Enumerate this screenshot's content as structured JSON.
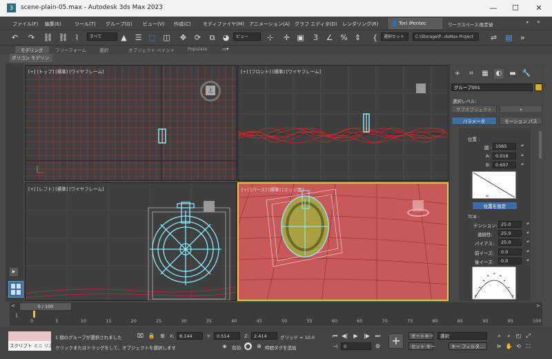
{
  "window": {
    "title": "scene-plain-05.max - Autodesk 3ds Max 2023",
    "app_icon": "3"
  },
  "menu": [
    "ファイル(F)",
    "編集(E)",
    "ツール(T)",
    "グループ(G)",
    "ビュー(V)",
    "作成(C)",
    "モディファイヤ(M)",
    "アニメーション(A)",
    "グラフ エディタ(D)",
    "レンダリング(R)"
  ],
  "user": {
    "name": "Tori iPentec",
    "workspace_label": "ワークスペース:",
    "workspace_value": "既定値"
  },
  "toolbar": {
    "selection_filter": "すべて",
    "ref_coord": "ビュー",
    "named_selection": "選択セット",
    "project_path": "C:\\Storage\\P...dsMax Project"
  },
  "ribbon": {
    "tabs": [
      "モデリング",
      "フリーフォーム",
      "選択",
      "オブジェクト ペイント",
      "Populate"
    ],
    "subtab": "ポリゴン モデリング"
  },
  "viewports": {
    "top": "[+] [トップ] [標準] [ワイヤフレーム]",
    "front": "[+] [フロント] [標準] [ワイヤフレーム]",
    "left": "[+] [レフト] [標準] [ワイヤフレーム]",
    "persp": "[+] [パース] [標準] [エッジ面]",
    "viewcube_top": "上"
  },
  "command_panel": {
    "object_name": "グループ001",
    "object_color": "#d4b21a",
    "selection_level_label": "選択レベル:",
    "sub_object_button": "サブオブジェクト",
    "params_button": "パラメータ",
    "motion_path_button": "モーション パス",
    "position_label": "位置 :",
    "frame_label": "図 :",
    "frame_value": "1065",
    "a_label": "A:",
    "a_value": "0.018",
    "b_label": "B:",
    "b_value": "0.607",
    "set_position_button": "位置を設定",
    "tcb_label": "TCB :",
    "tension_label": "テンション:",
    "tension_value": "25.0",
    "continuity_label": "連続性:",
    "continuity_value": "25.0",
    "bias_label": "バイアス:",
    "bias_value": "25.0",
    "ease_to_label": "前イーズ:",
    "ease_to_value": "0.0",
    "ease_from_label": "後イーズ:",
    "ease_from_value": "0.0"
  },
  "timeline": {
    "slider_text": "0 / 100",
    "ticks": [
      "0",
      "5",
      "10",
      "15",
      "20",
      "25",
      "30",
      "35",
      "40",
      "45",
      "50",
      "55",
      "60",
      "65",
      "70",
      "75",
      "80",
      "85",
      "90",
      "95",
      "100"
    ]
  },
  "status": {
    "maxscript_label": "スクリプト ミニ リス",
    "message1": "1 個のグループが選択されました",
    "message2": "クリックまたはドラッグをして、オブジェクトを選択します",
    "x_label": "X:",
    "x_value": "8.144",
    "y_label": "Y:",
    "y_value": "0.514",
    "z_label": "Z:",
    "z_value": "2.414",
    "grid_label": "グリッド = 10.0",
    "enabled_label": "有効:",
    "add_time_tag": "時間タグを追加",
    "frame_field": "0",
    "auto_key": "オートキー",
    "set_key": "セット キー",
    "key_filter": "キー フィルタ...",
    "select_dd": "選択"
  }
}
